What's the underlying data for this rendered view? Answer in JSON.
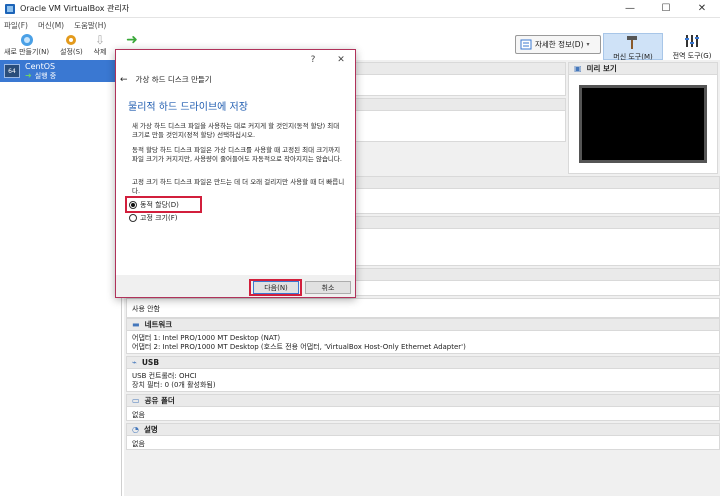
{
  "window": {
    "title": "Oracle VM VirtualBox 관리자",
    "minimize": "—",
    "maximize": "☐",
    "close": "✕"
  },
  "menu": [
    "파일(F)",
    "머신(M)",
    "도움말(H)"
  ],
  "toolbar": {
    "new_label": "새로 만들기(N)",
    "settings_label": "설정(S)",
    "discard_label": "삭제",
    "start_label": "",
    "detail_label": "자세한 정보(D)",
    "machine_tools_label": "머신 도구(M)",
    "global_tools_label": "전역 도구(G)"
  },
  "vm_list": [
    {
      "name": "CentOS",
      "state": "실행 중",
      "os_badge": "64"
    }
  ],
  "details": {
    "preview_title": "미리 보기",
    "serial_body": "사용 안함",
    "network_title": "네트워크",
    "network_lines": [
      "어댑터 1:  Intel PRO/1000 MT Desktop (NAT)",
      "어댑터 2:  Intel PRO/1000 MT Desktop (호스트 전용 어댑터, 'VirtualBox Host-Only Ethernet Adapter')"
    ],
    "usb_title": "USB",
    "usb_lines": [
      "USB 컨트롤러:  OHCI",
      "장치 필터:       0 (0개 활성화됨)"
    ],
    "shared_title": "공유 폴더",
    "shared_body": "없음",
    "desc_title": "설명",
    "desc_body": "없음"
  },
  "dialog": {
    "help": "?",
    "close": "✕",
    "back_arrow": "←",
    "subtitle": "가상 하드 디스크 만들기",
    "heading": "물리적 하드 드라이브에 저장",
    "para1": "새 가상 하드 디스크 파일을 사용하는 대로 커지게 할 것인지(동적 할당) 최대 크기로 만들 것인지(정적 할당) 선택하십시오.",
    "para2": "동적 할당 하드 디스크 파일은 가상 디스크를 사용할 때 고정된 최대 크기까지 파일 크기가 커지지만, 사용량이 줄어들어도 자동적으로 작아지지는 않습니다.",
    "para3": "고정 크기 하드 디스크 파일은 만드는 데 더 오래 걸리지만 사용할 때 더 빠릅니다.",
    "option_dynamic": "동적 할당(D)",
    "option_fixed": "고정 크기(F)",
    "selected": "dynamic",
    "next_label": "다음(N)",
    "cancel_label": "취소"
  }
}
